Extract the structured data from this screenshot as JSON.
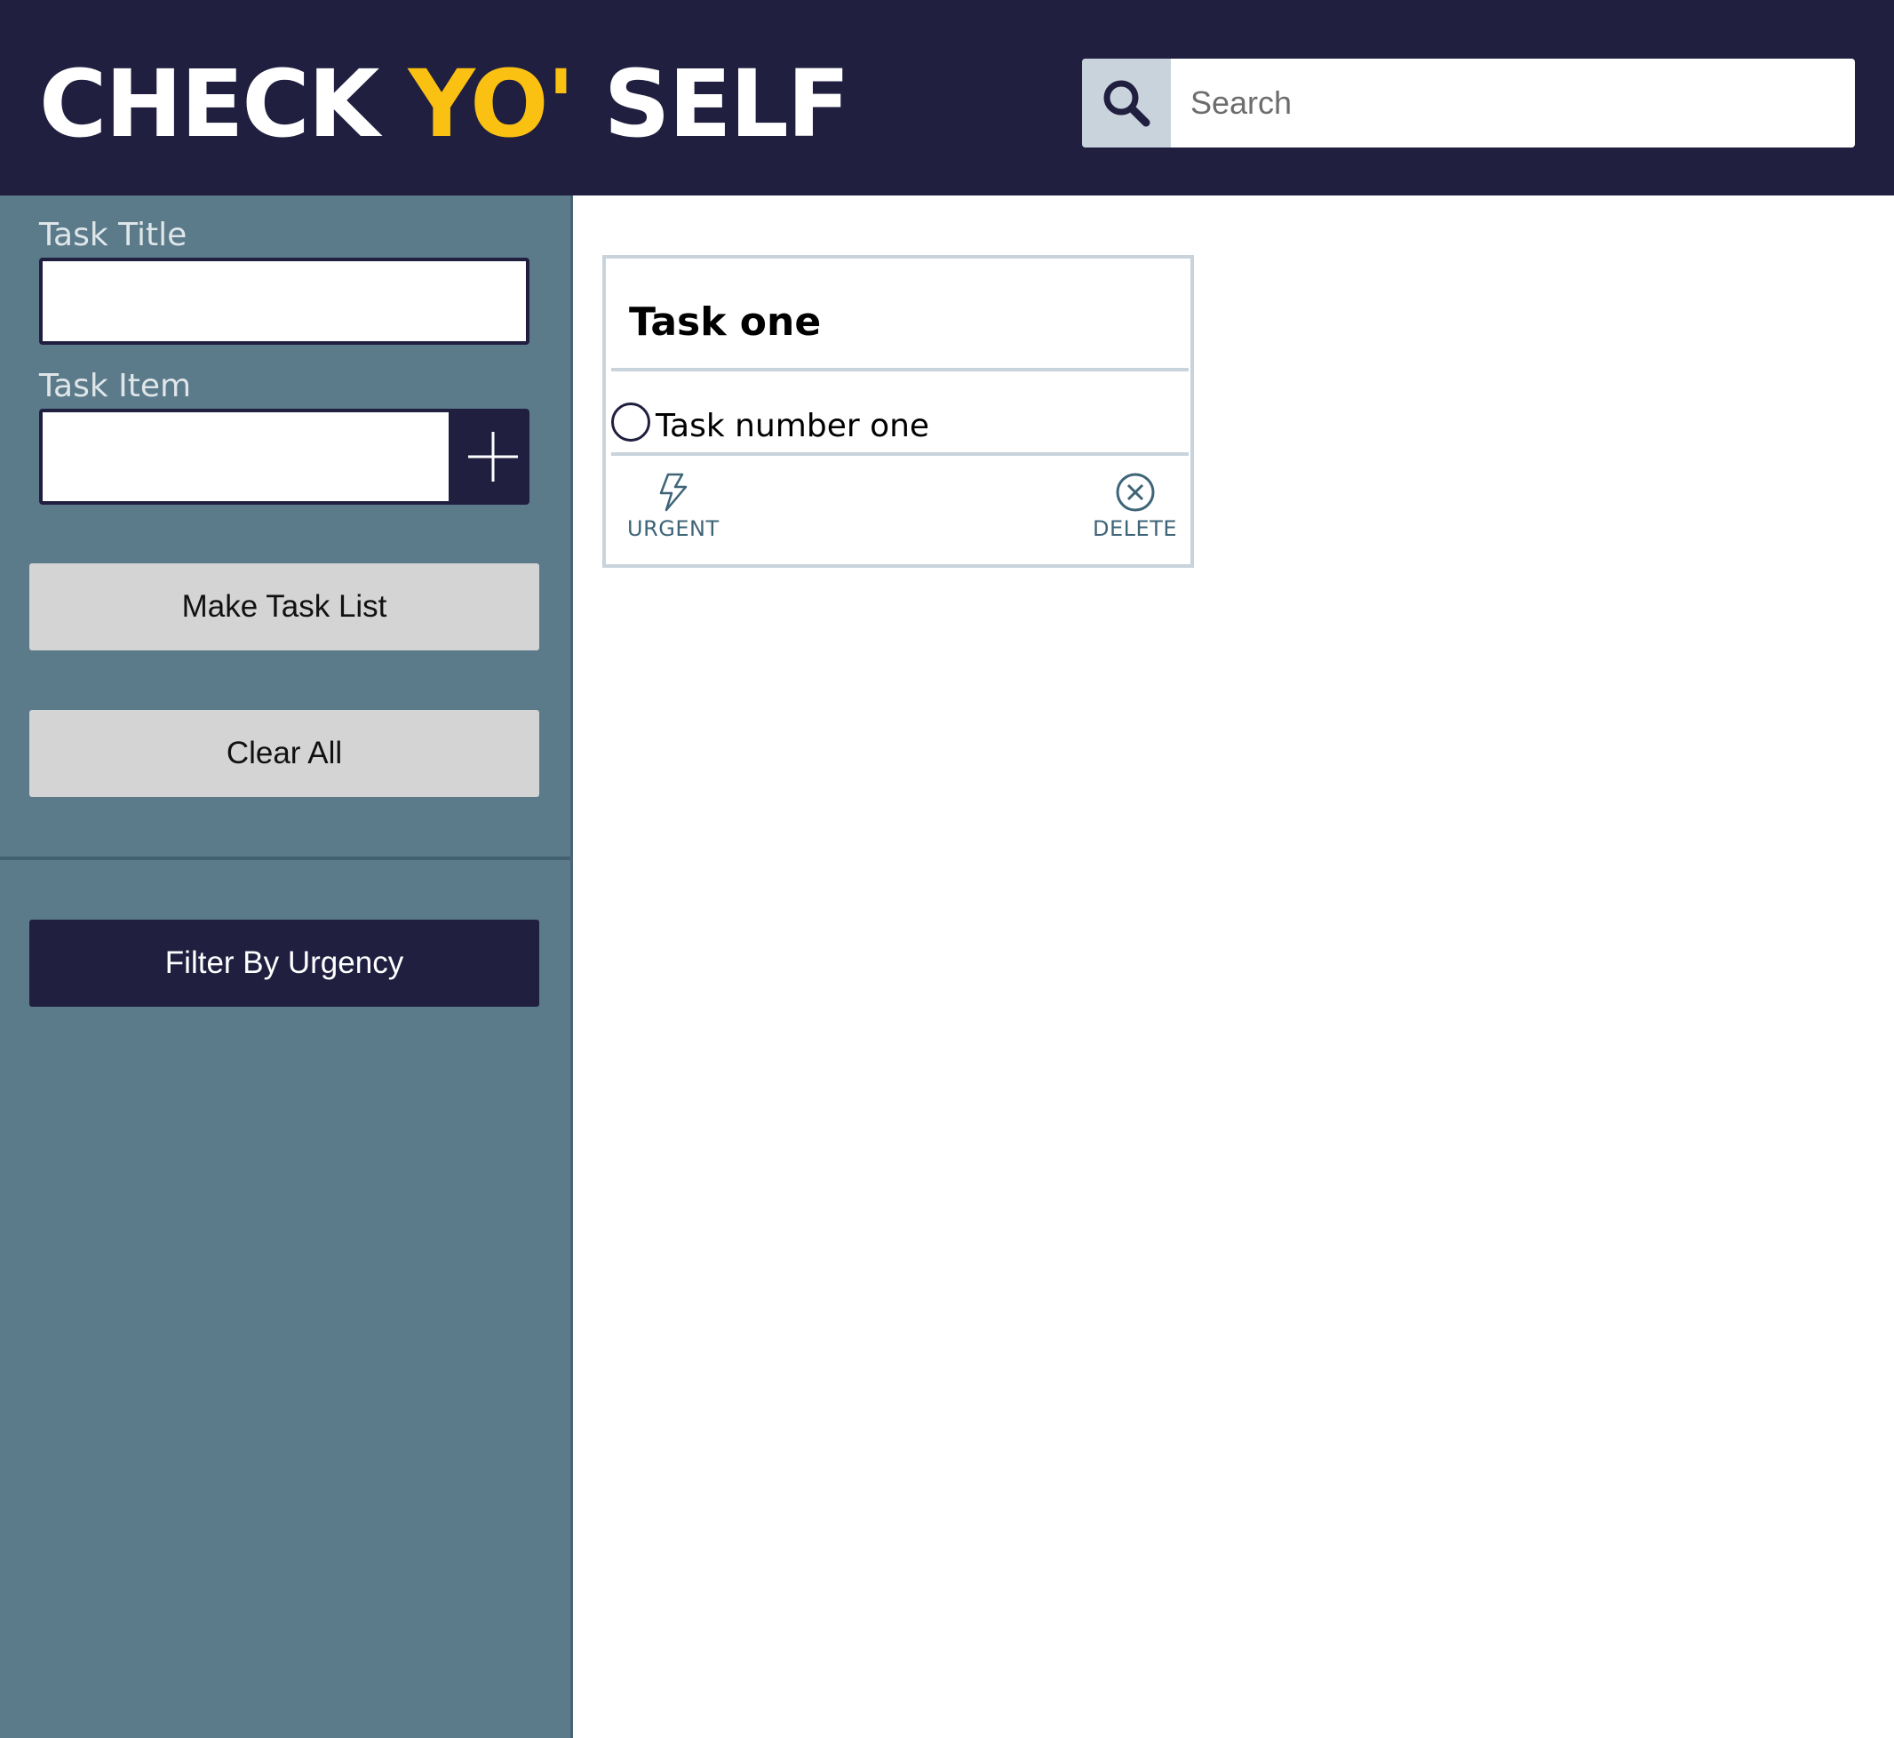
{
  "header": {
    "logo_part1": "CHECK ",
    "logo_part2": "YO'",
    "logo_part3": " SELF",
    "search": {
      "placeholder": "Search",
      "value": ""
    }
  },
  "sidebar": {
    "task_title_label": "Task Title",
    "task_title_value": "",
    "task_item_label": "Task Item",
    "task_item_value": "",
    "make_task_list_label": "Make Task List",
    "clear_all_label": "Clear All",
    "filter_urgency_label": "Filter By Urgency"
  },
  "cards": [
    {
      "title": "Task one",
      "items": [
        {
          "text": "Task number one",
          "checked": false
        }
      ],
      "urgent_label": "URGENT",
      "delete_label": "DELETE"
    }
  ],
  "colors": {
    "header_bg": "#201f40",
    "accent": "#fbc112",
    "sidebar_bg": "#5b7a8a",
    "button_gray": "#d4d4d4",
    "card_border": "#c8d3dc",
    "action_color": "#3e6477"
  },
  "icons": {
    "search": "magnifier-icon",
    "add": "plus-icon",
    "urgent": "lightning-icon",
    "delete": "circle-x-icon",
    "checkbox": "empty-circle-icon"
  }
}
